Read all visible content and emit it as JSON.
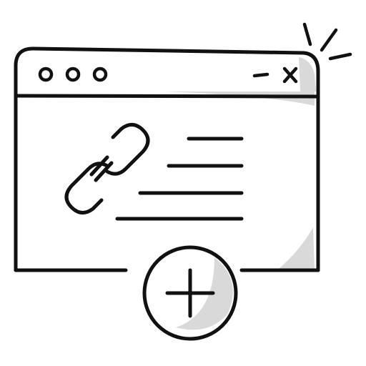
{
  "illustration": {
    "subject": "browser-window-with-link-and-add-button",
    "icons": {
      "window": "browser-window-icon",
      "dots": [
        "window-dot-icon",
        "window-dot-icon",
        "window-dot-icon"
      ],
      "minimize": "minimize-icon",
      "close": "close-icon",
      "link": "link-chain-icon",
      "text_lines": "text-lines-icon",
      "add": "plus-circle-icon",
      "sparkle": "sparkle-icon"
    },
    "colors": {
      "stroke": "#111111",
      "fill": "#ffffff",
      "shade": "#d9d9d9"
    }
  }
}
